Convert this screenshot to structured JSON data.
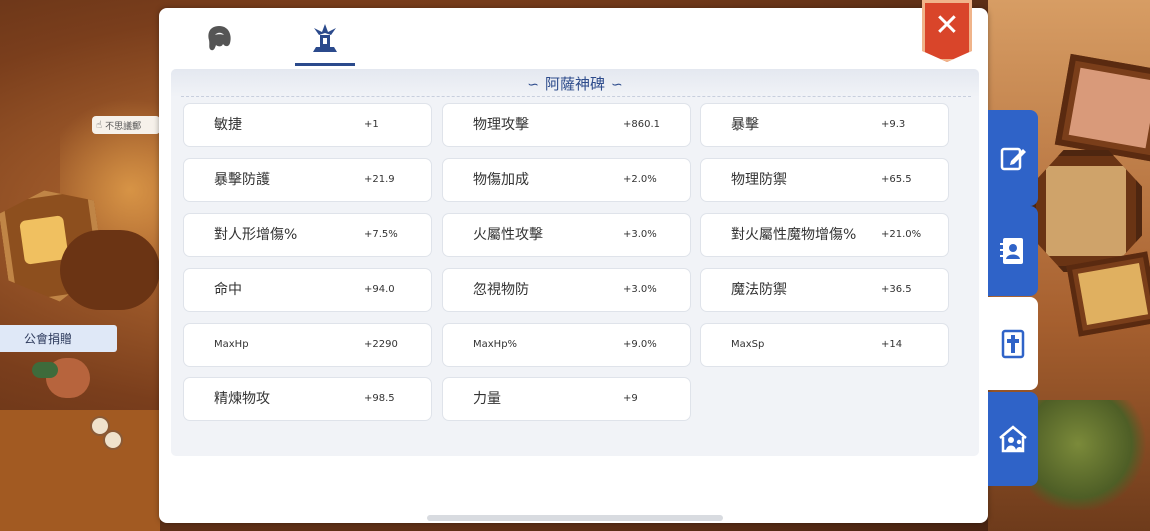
{
  "background": {
    "bubble_text": "不思議郵",
    "guild_button_label": "公會捐贈"
  },
  "panel": {
    "tabs": [
      {
        "icon": "hair-icon",
        "active": false
      },
      {
        "icon": "monument-icon",
        "active": true
      }
    ],
    "section_title": "阿薩神碑",
    "stats": [
      {
        "name": "敏捷",
        "value": "+1"
      },
      {
        "name": "物理攻擊",
        "value": "+860.1"
      },
      {
        "name": "暴擊",
        "value": "+9.3"
      },
      {
        "name": "暴擊防護",
        "value": "+21.9"
      },
      {
        "name": "物傷加成",
        "value": "+2.0%"
      },
      {
        "name": "物理防禦",
        "value": "+65.5"
      },
      {
        "name": "對人形增傷%",
        "value": "+7.5%"
      },
      {
        "name": "火屬性攻擊",
        "value": "+3.0%"
      },
      {
        "name": "對火屬性魔物增傷%",
        "value": "+21.0%"
      },
      {
        "name": "命中",
        "value": "+94.0"
      },
      {
        "name": "忽視物防",
        "value": "+3.0%"
      },
      {
        "name": "魔法防禦",
        "value": "+36.5"
      },
      {
        "name": "MaxHp",
        "value": "+2290"
      },
      {
        "name": "MaxHp%",
        "value": "+9.0%"
      },
      {
        "name": "MaxSp",
        "value": "+14"
      },
      {
        "name": "精煉物攻",
        "value": "+98.5"
      },
      {
        "name": "力量",
        "value": "+9"
      }
    ],
    "close_symbol": "✕"
  },
  "side_tabs": [
    {
      "icon": "edit-icon",
      "active": false
    },
    {
      "icon": "contacts-book-icon",
      "active": false
    },
    {
      "icon": "cross-scroll-icon",
      "active": true
    },
    {
      "icon": "guild-house-icon",
      "active": false
    }
  ],
  "colors": {
    "accent": "#2e4c8c",
    "side_tab": "#2f63c8",
    "close": "#d9452a"
  }
}
